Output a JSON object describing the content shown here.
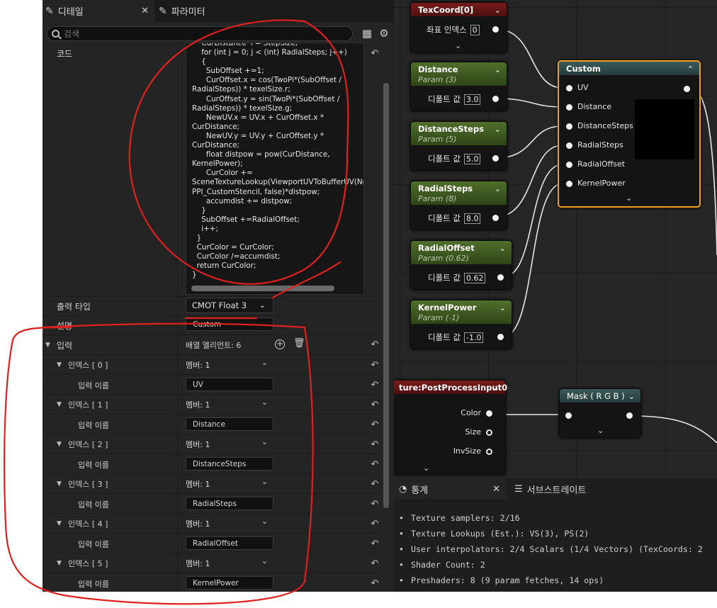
{
  "tabs": {
    "details": "디테일",
    "params": "파라미터"
  },
  "search": {
    "placeholder": "검색"
  },
  "code": {
    "label": "코드",
    "text": "    CurDistance += StepSize;\n    for (int j = 0; j < (int) RadialSteps; j++)\n    {\n      SubOffset +=1;\n      CurOffset.x = cos(TwoPi*(SubOffset / RadialSteps)) * texelSize.r;\n      CurOffset.y = sin(TwoPi*(SubOffset / RadialSteps)) * texelSize.g;\n      NewUV.x = UV.x + CurOffset.x * CurDistance;\n      NewUV.y = UV.y + CurOffset.y * CurDistance;\n      float distpow = pow(CurDistance, KernelPower);\n      CurColor += SceneTextureLookup(ViewportUVToBufferUV(NewUV), PPI_CustomStencil, false)*distpow;\n      accumdist += distpow;\n    }\n    SubOffset +=RadialOffset;\n    i++;\n  }\n  CurColor = CurColor;\n  CurColor /=accumdist;\n  return CurColor;\n}"
  },
  "output_type": {
    "label": "출력 타입",
    "value": "CMOT Float 3"
  },
  "description": {
    "label": "설명",
    "value": "Custom"
  },
  "inputs": {
    "label": "입력",
    "count_label": "배열 엘리먼트: 6",
    "items": [
      {
        "index_label": "인덱스 [ 0 ]",
        "member": "멤버: 1",
        "name_label": "입력 이름",
        "name": "UV"
      },
      {
        "index_label": "인덱스 [ 1 ]",
        "member": "멤버: 1",
        "name_label": "입력 이름",
        "name": "Distance"
      },
      {
        "index_label": "인덱스 [ 2 ]",
        "member": "멤버: 1",
        "name_label": "입력 이름",
        "name": "DistanceSteps"
      },
      {
        "index_label": "인덱스 [ 3 ]",
        "member": "멤버: 1",
        "name_label": "입력 이름",
        "name": "RadialSteps"
      },
      {
        "index_label": "인덱스 [ 4 ]",
        "member": "멤버: 1",
        "name_label": "입력 이름",
        "name": "RadialOffset"
      },
      {
        "index_label": "인덱스 [ 5 ]",
        "member": "멤버: 1",
        "name_label": "입력 이름",
        "name": "KernelPower"
      }
    ]
  },
  "graph": {
    "texcoord": {
      "title": "TexCoord[0]",
      "row_label": "좌표 인덱스",
      "value": "0"
    },
    "params": [
      {
        "title": "Distance",
        "sub": "Param (3)",
        "row_label": "디폴트 값",
        "value": "3.0"
      },
      {
        "title": "DistanceSteps",
        "sub": "Param (5)",
        "row_label": "디폴트 값",
        "value": "5.0"
      },
      {
        "title": "RadialSteps",
        "sub": "Param (8)",
        "row_label": "디폴트 값",
        "value": "8.0"
      },
      {
        "title": "RadialOffset",
        "sub": "Param (0.62)",
        "row_label": "디폴트 값",
        "value": "0.62"
      },
      {
        "title": "KernelPower",
        "sub": "Param (-1)",
        "row_label": "디폴트 값",
        "value": "-1.0"
      }
    ],
    "custom": {
      "title": "Custom",
      "inputs": [
        "UV",
        "Distance",
        "DistanceSteps",
        "RadialSteps",
        "RadialOffset",
        "KernelPower"
      ]
    },
    "scene_texture": {
      "title": "ture:PostProcessInput0",
      "outputs": [
        "Color",
        "Size",
        "InvSize"
      ]
    },
    "mask": {
      "title": "Mask ( R G B )"
    }
  },
  "stats": {
    "tab_stats": "통계",
    "tab_substrate": "서브스트레이트",
    "lines": [
      "Texture samplers: 2/16",
      "Texture Lookups (Est.): VS(3), PS(2)",
      "User interpolators: 2/4 Scalars (1/4 Vectors) (TexCoords: 2",
      "Shader Count: 2",
      "Preshaders: 8  (9 param fetches, 14 ops)"
    ]
  },
  "colors": {
    "node_selected": "#f0a020",
    "annotation": "#e0201e"
  }
}
